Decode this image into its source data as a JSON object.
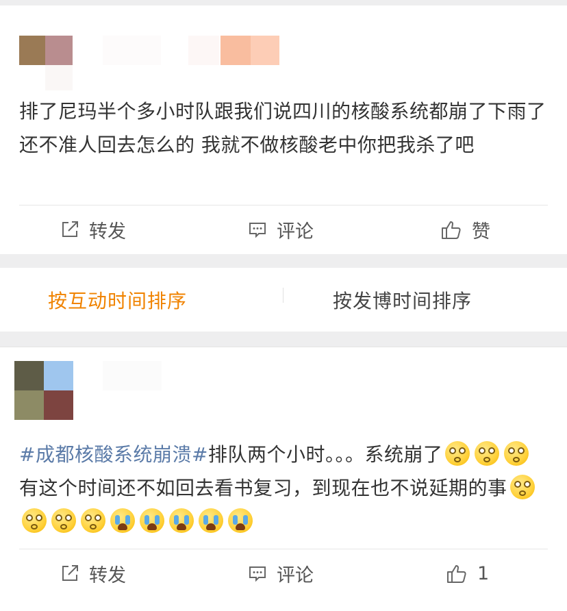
{
  "post1": {
    "text": "排了尼玛半个多小时队跟我们说四川的核酸系统都崩了下雨了还不准人回去怎么的 我就不做核酸老中你把我杀了吧",
    "actions": {
      "forward": "转发",
      "comment": "评论",
      "like": "赞"
    }
  },
  "sort_tabs": {
    "active": "按互动时间排序",
    "other": "按发博时间排序",
    "active_color": "#f08300"
  },
  "post2": {
    "topic": "#成都核酸系统崩溃#",
    "text_parts": [
      "排队两个小时。。。系统崩了",
      "有这个时间还不如回去看书复习，到现在也不说延期的事"
    ],
    "emojis": [
      "dizzy-face",
      "dizzy-face",
      "dizzy-face",
      "dizzy-face",
      "dizzy-face",
      "dizzy-face",
      "dizzy-face",
      "crying-face",
      "crying-face",
      "crying-face",
      "crying-face",
      "crying-face"
    ],
    "actions": {
      "forward": "转发",
      "comment": "评论",
      "like_count": "1"
    }
  },
  "colors": {
    "topic": "#5b7ba8",
    "background": "#eeeeef"
  }
}
